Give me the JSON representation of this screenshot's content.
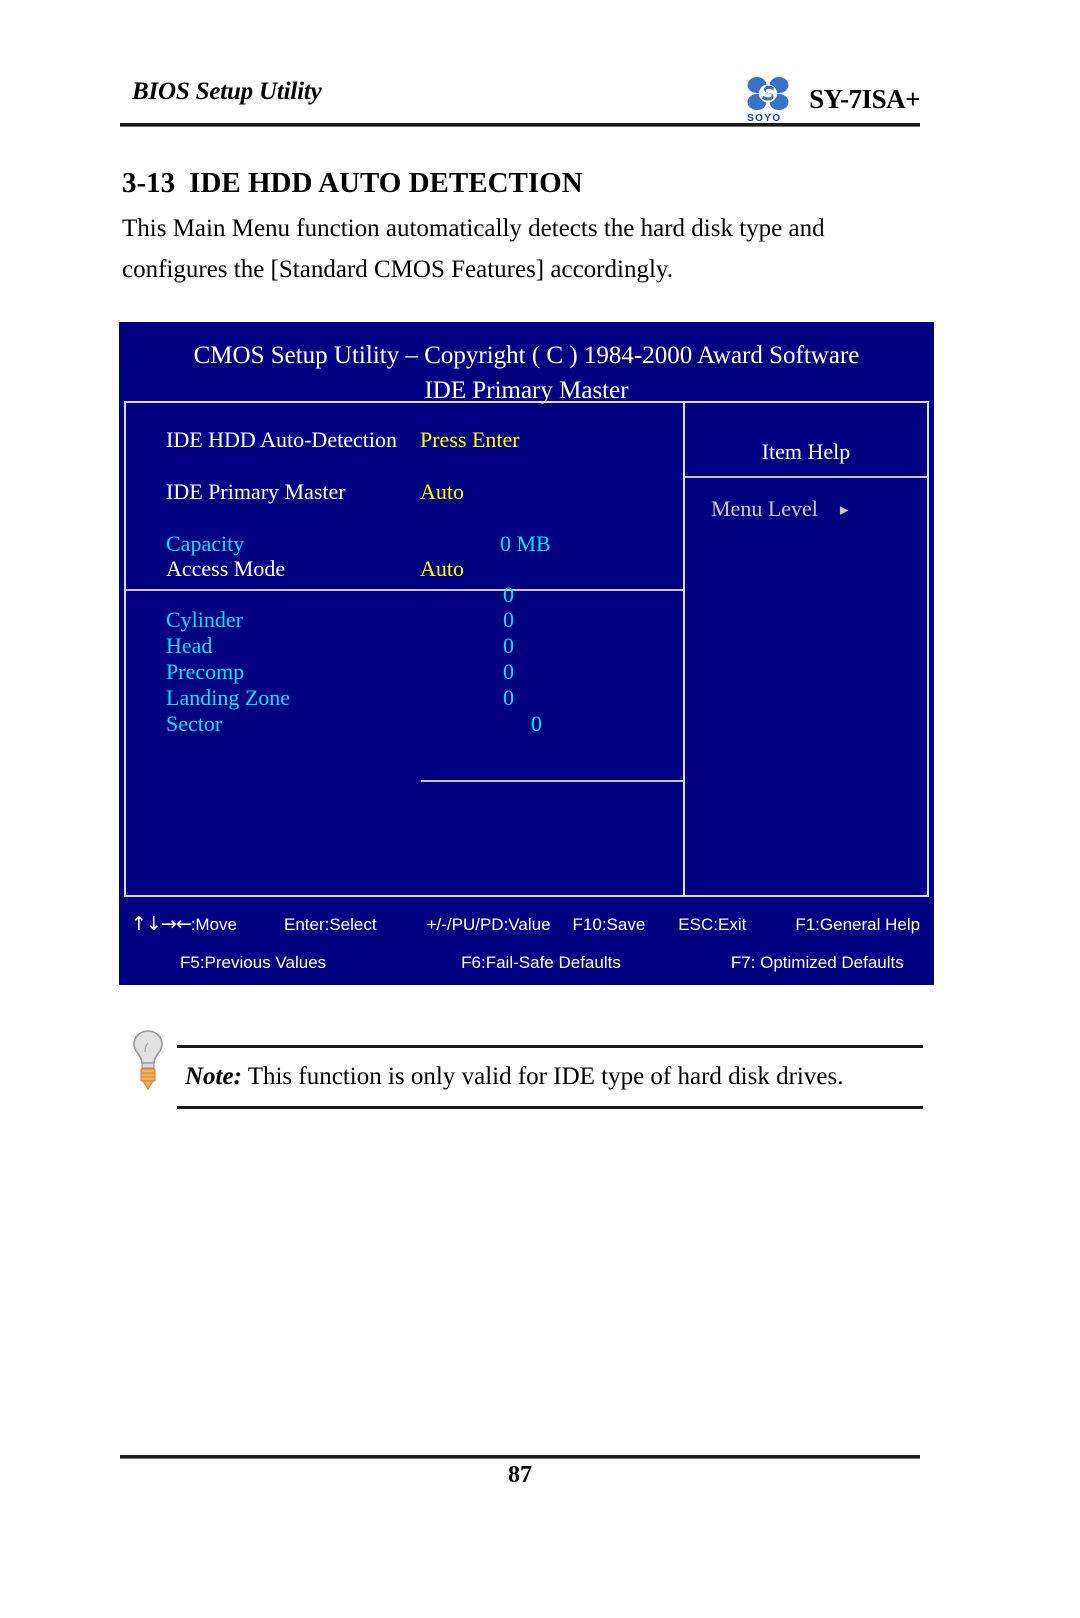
{
  "header": {
    "title": "BIOS Setup Utility",
    "model": "SY-7ISA+",
    "logo_wordmark": "SOYO"
  },
  "section": {
    "number": "3-13",
    "heading": "IDE HDD AUTO DETECTION",
    "intro": "This Main Menu function automatically detects the hard disk type and configures the [Standard CMOS Features] accordingly."
  },
  "bios": {
    "title_line1": "CMOS Setup Utility – Copyright ( C ) 1984-2000 Award Software",
    "title_line2": "IDE Primary Master",
    "rows": [
      {
        "label": "IDE HDD Auto-Detection",
        "value": "Press Enter",
        "label_color": "white",
        "value_color": "yellow"
      },
      {
        "label": "IDE Primary Master",
        "value": "Auto",
        "label_color": "white",
        "value_color": "yellow"
      },
      {
        "label": "Capacity",
        "value": "0 MB",
        "label_color": "cyan",
        "value_color": "cyan"
      },
      {
        "label": "Access Mode",
        "value": "Auto",
        "label_color": "white",
        "value_color": "yellow"
      },
      {
        "label": "",
        "value": "0",
        "label_color": "cyan",
        "value_color": "cyan"
      },
      {
        "label": "Cylinder",
        "value": "0",
        "label_color": "cyan",
        "value_color": "cyan"
      },
      {
        "label": "Head",
        "value": "0",
        "label_color": "cyan",
        "value_color": "cyan"
      },
      {
        "label": "Precomp",
        "value": "0",
        "label_color": "cyan",
        "value_color": "cyan"
      },
      {
        "label": "Landing Zone",
        "value": "0",
        "label_color": "cyan",
        "value_color": "cyan"
      },
      {
        "label": "Sector",
        "value": "0",
        "label_color": "cyan",
        "value_color": "cyan"
      }
    ],
    "help": {
      "title": "Item Help",
      "menu_level_label": "Menu Level",
      "menu_level_arrow": "▸"
    },
    "keybar": {
      "arrows": "↑↓→←",
      "move": ":Move",
      "select": "Enter:Select",
      "value": "+/-/PU/PD:Value",
      "save": "F10:Save",
      "exit": "ESC:Exit",
      "general_help": "F1:General Help",
      "previous_values": "F5:Previous Values",
      "fail_safe": "F6:Fail-Safe Defaults",
      "optimized": "F7: Optimized Defaults"
    },
    "colors": {
      "background": "#000080",
      "border": "#dcdcdc",
      "white": "#ffffff",
      "yellow": "#ffff00",
      "cyan": "#00e5ff",
      "gray": "#c8c8c8"
    }
  },
  "note": {
    "word": "Note:",
    "text": " This function is only valid for IDE type of hard disk drives."
  },
  "footer": {
    "page_number": "87"
  }
}
